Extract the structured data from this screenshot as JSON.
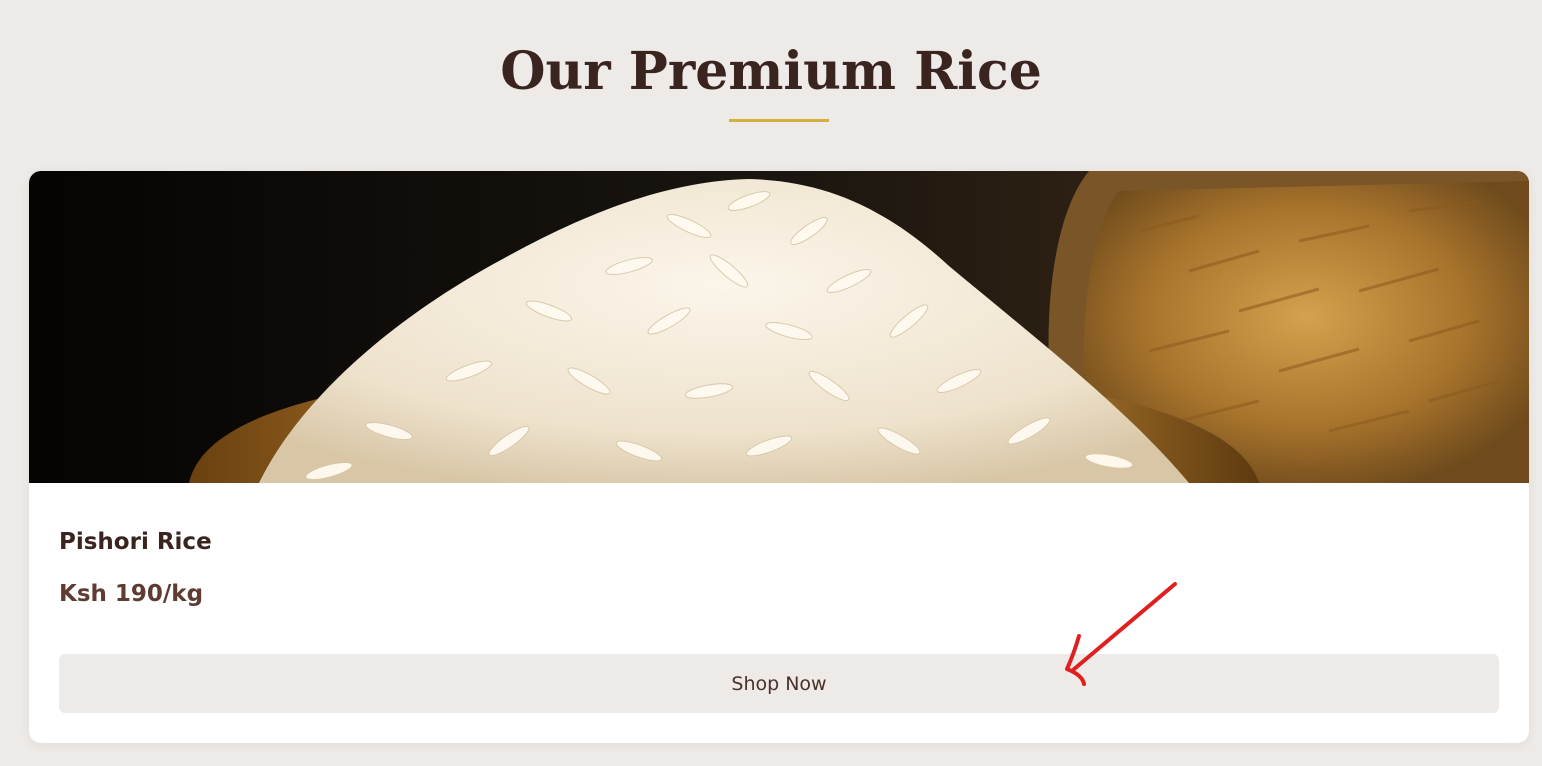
{
  "section": {
    "title": "Our Premium Rice"
  },
  "colors": {
    "background": "#eeeae7",
    "heading": "#3a2420",
    "accent_underline": "#d4b040",
    "price": "#5e3c32",
    "button_bg": "#eeeae7",
    "annotation": "#e02020"
  },
  "product": {
    "name": "Pishori Rice",
    "price": "Ksh 190/kg",
    "button_label": "Shop Now",
    "image_icon": "rice-bowl-photo"
  },
  "annotation": {
    "icon": "red-arrow-icon"
  }
}
